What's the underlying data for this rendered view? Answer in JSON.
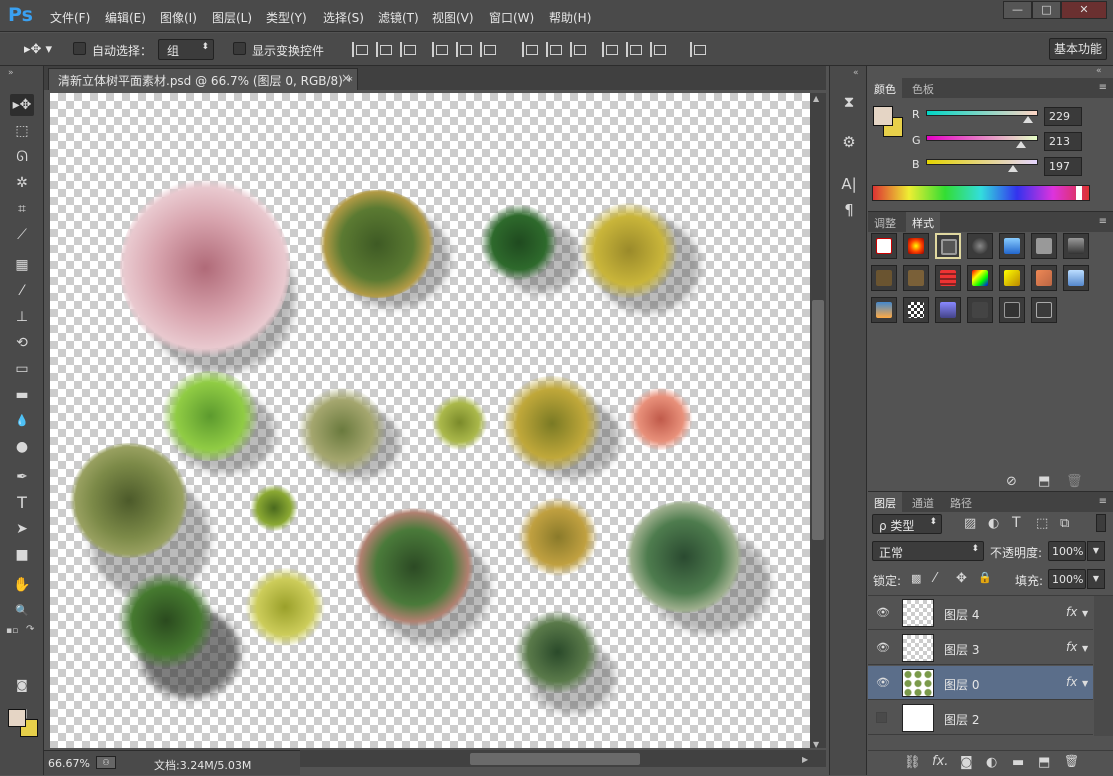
{
  "app": {
    "logo": "Ps"
  },
  "menu": [
    "文件(F)",
    "编辑(E)",
    "图像(I)",
    "图层(L)",
    "类型(Y)",
    "选择(S)",
    "滤镜(T)",
    "视图(V)",
    "窗口(W)",
    "帮助(H)"
  ],
  "window_controls": {
    "minimize": "—",
    "maximize": "□",
    "close": "✕"
  },
  "options": {
    "auto_select_label": "自动选择：",
    "auto_select_checked": false,
    "auto_select_target": "组",
    "show_transform_label": "显示变换控件",
    "show_transform_checked": false,
    "workspace": "基本功能"
  },
  "document": {
    "tab_title": "清新立体树平面素材.psd @ 66.7% (图层 0, RGB/8) *",
    "close": "×",
    "zoom": "66.67%",
    "doc_info": "文档:3.24M/5.03M"
  },
  "tools": [
    {
      "name": "move-tool",
      "glyph": "▸✥"
    },
    {
      "name": "marquee-tool",
      "glyph": "⬚"
    },
    {
      "name": "lasso-tool",
      "glyph": "ᘏ"
    },
    {
      "name": "magic-wand-tool",
      "glyph": "✲"
    },
    {
      "name": "crop-tool",
      "glyph": "⌗"
    },
    {
      "name": "eyedropper-tool",
      "glyph": "⟋"
    },
    {
      "name": "healing-brush-tool",
      "glyph": "▦"
    },
    {
      "name": "brush-tool",
      "glyph": "⁄"
    },
    {
      "name": "clone-stamp-tool",
      "glyph": "⊥"
    },
    {
      "name": "history-brush-tool",
      "glyph": "⟲"
    },
    {
      "name": "eraser-tool",
      "glyph": "▭"
    },
    {
      "name": "gradient-tool",
      "glyph": "▬"
    },
    {
      "name": "blur-tool",
      "glyph": "💧"
    },
    {
      "name": "dodge-tool",
      "glyph": "●"
    },
    {
      "name": "pen-tool",
      "glyph": "✒"
    },
    {
      "name": "type-tool",
      "glyph": "T"
    },
    {
      "name": "path-selection-tool",
      "glyph": "➤"
    },
    {
      "name": "rectangle-tool",
      "glyph": "■"
    },
    {
      "name": "hand-tool",
      "glyph": "✋"
    },
    {
      "name": "zoom-tool",
      "glyph": "🔍"
    }
  ],
  "colors": {
    "foreground": "#e5d5c5",
    "background": "#e7d04a"
  },
  "color_panel": {
    "tabs": [
      "颜色",
      "色板"
    ],
    "r_label": "R",
    "g_label": "G",
    "b_label": "B",
    "r": "229",
    "g": "213",
    "b": "197"
  },
  "styles_panel": {
    "tabs": [
      "调整",
      "样式"
    ]
  },
  "layers_panel": {
    "tabs": [
      "图层",
      "通道",
      "路径"
    ],
    "filter_label": "ρ 类型",
    "blend_mode": "正常",
    "opacity_label": "不透明度:",
    "opacity": "100%",
    "lock_label": "锁定:",
    "fill_label": "填充:",
    "fill": "100%",
    "layers": [
      {
        "name": "图层 4",
        "visible": true,
        "fx": "fx",
        "selected": false
      },
      {
        "name": "图层 3",
        "visible": true,
        "fx": "fx",
        "selected": false
      },
      {
        "name": "图层 0",
        "visible": true,
        "fx": "fx",
        "selected": true
      },
      {
        "name": "图层 2",
        "visible": false,
        "fx": "",
        "selected": false
      }
    ]
  }
}
